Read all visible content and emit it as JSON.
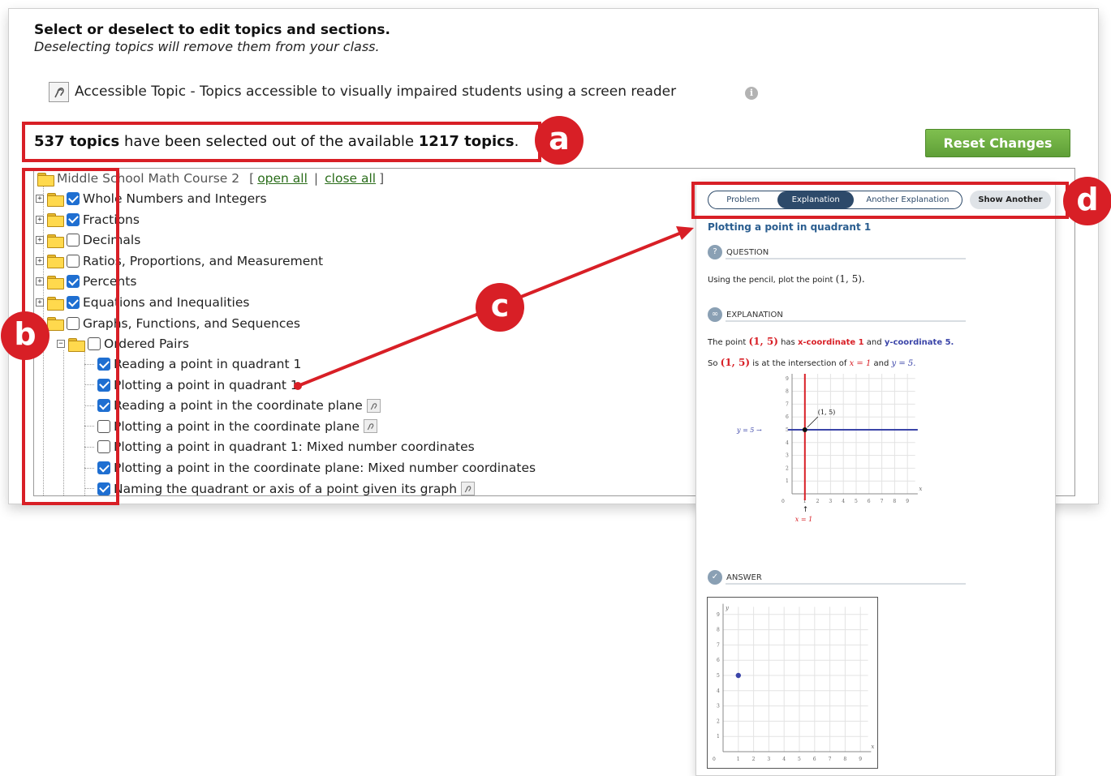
{
  "header": {
    "title": "Select or deselect to edit topics and sections.",
    "subtitle": "Deselecting topics will remove them from your class.",
    "accessible_legend": "Accessible Topic - Topics accessible to visually impaired students using a screen reader"
  },
  "selection_summary": {
    "selected_count": "537 topics",
    "middle_text": " have been selected out of the available ",
    "available_count": "1217 topics",
    "end": "."
  },
  "reset_button": "Reset Changes",
  "tree": {
    "root_label": "Middle School Math Course 2",
    "open_all": "open all",
    "close_all": "close all",
    "bracket_open": "[",
    "separator": "|",
    "bracket_close": "]",
    "sections": [
      {
        "label": "Whole Numbers and Integers",
        "checked": true
      },
      {
        "label": "Fractions",
        "checked": true
      },
      {
        "label": "Decimals",
        "checked": false
      },
      {
        "label": "Ratios, Proportions, and Measurement",
        "checked": false
      },
      {
        "label": "Percents",
        "checked": true
      },
      {
        "label": "Equations and Inequalities",
        "checked": true
      },
      {
        "label": "Graphs, Functions, and Sequences",
        "checked": false
      }
    ],
    "subsection": {
      "label": "Ordered Pairs",
      "checked": false
    },
    "topics": [
      {
        "label": "Reading a point in quadrant 1",
        "checked": true,
        "accessible": false
      },
      {
        "label": "Plotting a point in quadrant 1",
        "checked": true,
        "accessible": false
      },
      {
        "label": "Reading a point in the coordinate plane",
        "checked": true,
        "accessible": true
      },
      {
        "label": "Plotting a point in the coordinate plane",
        "checked": false,
        "accessible": true
      },
      {
        "label": "Plotting a point in quadrant 1: Mixed number coordinates",
        "checked": false,
        "accessible": false
      },
      {
        "label": "Plotting a point in the coordinate plane: Mixed number coordinates",
        "checked": true,
        "accessible": false
      },
      {
        "label": "Naming the quadrant or axis of a point given its graph",
        "checked": true,
        "accessible": true
      }
    ]
  },
  "callouts": {
    "a": "a",
    "b": "b",
    "c": "c",
    "d": "d"
  },
  "panel": {
    "tabs": [
      "Problem",
      "Explanation",
      "Another Explanation"
    ],
    "active_tab": "Explanation",
    "show_another": "Show Another",
    "title": "Plotting a point in quadrant 1",
    "question_head": "QUESTION",
    "question_text": "Using the pencil, plot the point",
    "question_point": "(1, 5).",
    "explanation_head": "EXPLANATION",
    "exp_line1_a": "The point",
    "exp_point": "(1, 5)",
    "exp_line1_b": "has",
    "exp_x_label": "x-coordinate 1",
    "exp_and": "and",
    "exp_y_label": "y-coordinate 5.",
    "exp_line2_a": "So",
    "exp_line2_b": "is at the intersection of",
    "exp_x_eq": "x = 1",
    "exp_y_eq": "y = 5.",
    "graph_point_label": "(1, 5)",
    "graph_y_label": "y = 5",
    "graph_x_label": "x = 1",
    "answer_head": "ANSWER",
    "axis_x": "x",
    "axis_y": "y",
    "ticks": [
      "1",
      "2",
      "3",
      "4",
      "5",
      "6",
      "7",
      "8",
      "9"
    ],
    "origin": "0",
    "accent_red": "#d81f26",
    "accent_blue": "#3a44a8",
    "answer_point_color": "#3a44a8"
  }
}
